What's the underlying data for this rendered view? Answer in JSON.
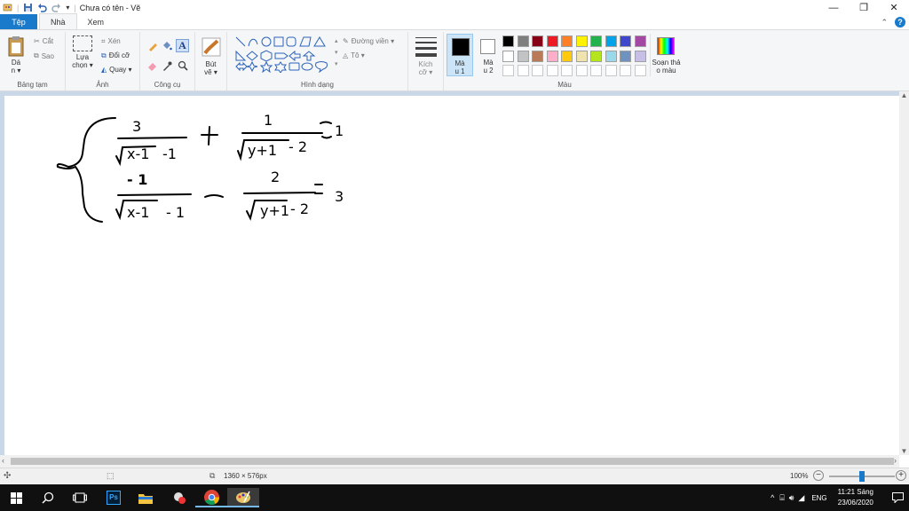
{
  "window": {
    "title": "Chưa có tên - Vẽ"
  },
  "tabs": {
    "file": "Tệp",
    "home": "Nhà",
    "view": "Xem"
  },
  "ribbon": {
    "clipboard": {
      "paste": "Dá\nn ▾",
      "cut": "Cắt",
      "copy": "Sao",
      "label": "Bảng tạm"
    },
    "image": {
      "select": "Lựa\nchọn ▾",
      "crop": "Xén",
      "resize": "Đổi cỡ",
      "rotate": "Quay ▾",
      "label": "Ảnh"
    },
    "tools": {
      "label": "Công cụ"
    },
    "brushes": {
      "label": "Bút\nvẽ ▾"
    },
    "shapes": {
      "outline": "Đường viền ▾",
      "fill": "Tô ▾",
      "label": "Hình dạng"
    },
    "size": {
      "label": "Kích\ncỡ ▾"
    },
    "color1": {
      "label": "Mà\nu 1"
    },
    "color2": {
      "label": "Mà\nu 2"
    },
    "edit_colors": {
      "label": "Soạn thả\no màu"
    },
    "colors": {
      "label": "Màu"
    }
  },
  "palette": {
    "row1": [
      "#000000",
      "#7f7f7f",
      "#880015",
      "#ed1c24",
      "#ff7f27",
      "#fff200",
      "#22b14c",
      "#00a2e8",
      "#3f48cc",
      "#a349a4"
    ],
    "row2": [
      "#ffffff",
      "#c3c3c3",
      "#b97a57",
      "#ffaec9",
      "#ffc90e",
      "#efe4b0",
      "#b5e61d",
      "#99d9ea",
      "#7092be",
      "#c8bfe7"
    ],
    "row3": [
      "#ffffff",
      "#ffffff",
      "#ffffff",
      "#ffffff",
      "#ffffff",
      "#ffffff",
      "#ffffff",
      "#ffffff",
      "#ffffff",
      "#ffffff"
    ]
  },
  "canvas": {
    "eq1": {
      "num1": "3",
      "den1_root": "x-1",
      "den1_rest": "-1",
      "op": "+",
      "num2": "1",
      "den2_root": "y+1",
      "den2_rest": "- 2",
      "rhs": "1"
    },
    "eq2": {
      "num1": "- 1",
      "den1_root": "x-1",
      "den1_rest": "- 1",
      "op": "—",
      "num2": "2",
      "den2_root": "y+1",
      "den2_rest": "- 2",
      "rhs": "3"
    }
  },
  "status": {
    "dimensions": "1360 × 576px",
    "zoom": "100%",
    "zoom_level": 0.5
  },
  "taskbar": {
    "language": "ENG",
    "time": "11:21 Sáng",
    "date": "23/06/2020"
  }
}
